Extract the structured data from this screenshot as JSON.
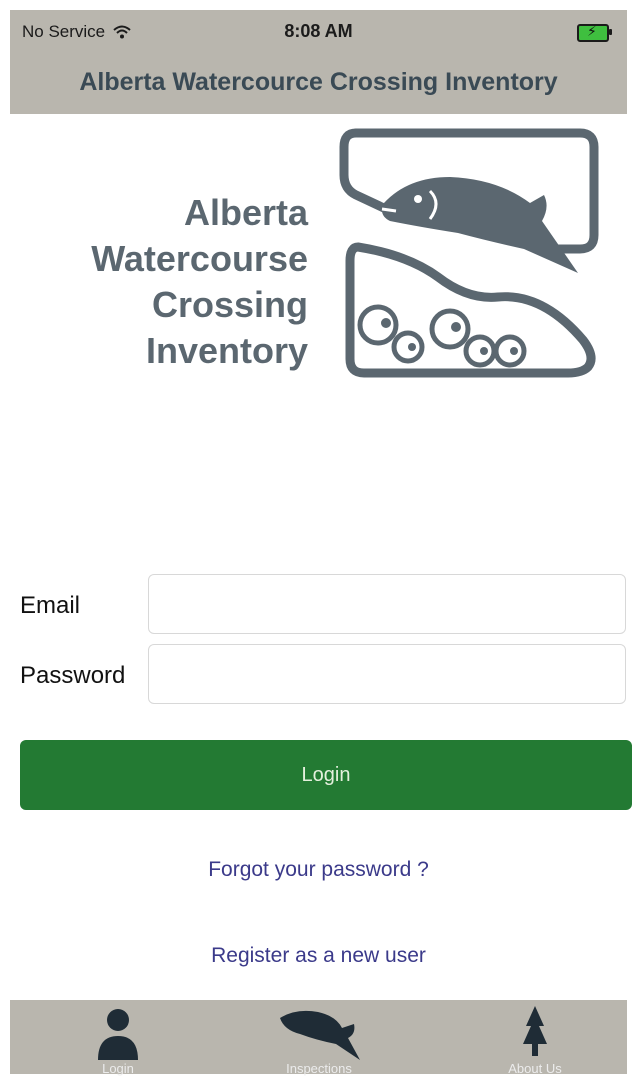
{
  "status": {
    "carrier": "No Service",
    "time": "8:08 AM"
  },
  "nav": {
    "title": "Alberta Watercource Crossing Inventory"
  },
  "logo": {
    "line1": "Alberta",
    "line2": "Watercourse",
    "line3": "Crossing",
    "line4": "Inventory"
  },
  "form": {
    "email_label": "Email",
    "email_value": "",
    "password_label": "Password",
    "password_value": "",
    "login_label": "Login"
  },
  "links": {
    "forgot": "Forgot your password ?",
    "register": "Register as a new user"
  },
  "tabs": [
    {
      "label": "Login",
      "icon": "person-icon"
    },
    {
      "label": "Inspections",
      "icon": "fish-icon"
    },
    {
      "label": "About Us",
      "icon": "tree-icon"
    }
  ],
  "colors": {
    "bar": "#b9b6ae",
    "login_button": "#237a33",
    "link": "#3b3a8a",
    "logo": "#5b6770"
  }
}
